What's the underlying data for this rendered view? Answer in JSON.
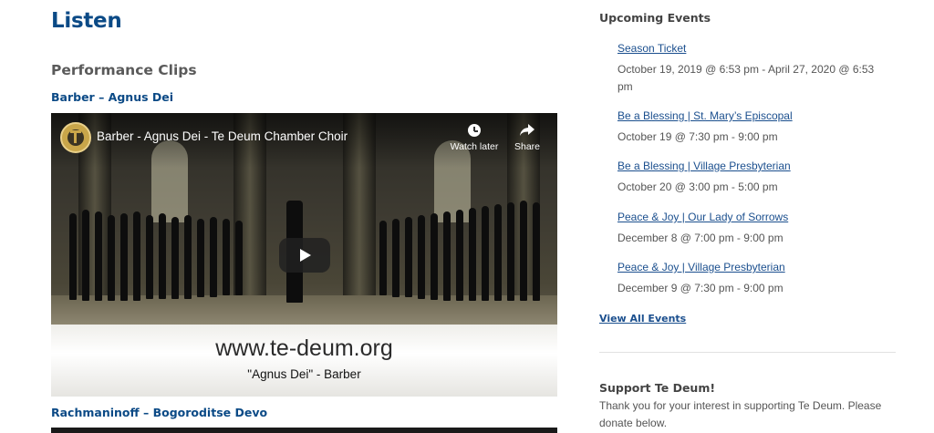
{
  "main": {
    "title": "Listen",
    "section_heading": "Performance Clips",
    "clips": [
      {
        "title": "Barber – Agnus Dei",
        "video": {
          "title": "Barber - Agnus Dei - Te Deum Chamber Choir",
          "watch_later_label": "Watch later",
          "share_label": "Share",
          "overlay_url": "www.te-deum.org",
          "overlay_caption": "\"Agnus Dei\" - Barber"
        }
      },
      {
        "title": "Rachmaninoff – Bogoroditse Devo"
      }
    ]
  },
  "sidebar": {
    "events_heading": "Upcoming Events",
    "events": [
      {
        "title": "Season Ticket",
        "date": "October 19, 2019 @ 6:53 pm - April 27, 2020 @ 6:53 pm"
      },
      {
        "title": "Be a Blessing | St. Mary’s Episcopal",
        "date": "October 19 @ 7:30 pm - 9:00 pm"
      },
      {
        "title": "Be a Blessing | Village Presbyterian",
        "date": "October 20 @ 3:00 pm - 5:00 pm"
      },
      {
        "title": "Peace & Joy | Our Lady of Sorrows",
        "date": "December 8 @ 7:00 pm - 9:00 pm"
      },
      {
        "title": "Peace & Joy | Village Presbyterian",
        "date": "December 9 @ 7:30 pm - 9:00 pm"
      }
    ],
    "view_all_label": "View All Events",
    "support_heading": "Support Te Deum!",
    "support_text": "Thank you for your interest in supporting Te Deum. Please donate below."
  },
  "icons": {
    "channel_logo": "te-deum-logo-icon",
    "watch_later": "clock-icon",
    "share": "share-arrow-icon",
    "play": "play-icon"
  },
  "colors": {
    "title_blue": "#0b4a86",
    "link_blue": "#1b4f8e",
    "heading_gray": "#5a5a5a"
  }
}
